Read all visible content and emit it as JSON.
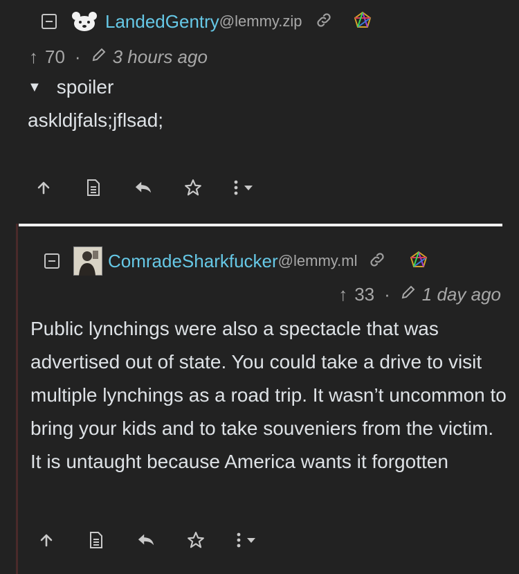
{
  "comments": [
    {
      "username": "LandedGentry",
      "instance": "@lemmy.zip",
      "score": "70",
      "arrow": "↑",
      "separator": "·",
      "time_ago": "3 hours ago",
      "spoiler_label": "spoiler",
      "spoiler_marker": "▼",
      "body": "askldjfals;jflsad;"
    },
    {
      "username": "ComradeSharkfucker",
      "instance": "@lemmy.ml",
      "score": "33",
      "arrow": "↑",
      "separator": "·",
      "time_ago": "1 day ago",
      "body": "Public lynchings were also a spectacle that was advertised out of state. You could take a drive to visit multiple lynchings as a road trip. It wasn’t uncommon to bring your kids and to take souveniers from the victim. It is untaught because America wants it forgotten"
    }
  ],
  "icons": {
    "collapse": "collapse-icon",
    "link": "link-icon",
    "fediverse": "fediverse-icon",
    "upvote": "upvote-icon",
    "source": "view-source-icon",
    "reply": "reply-icon",
    "save": "save-star-icon",
    "more": "more-options-icon",
    "edit": "edit-pencil-icon"
  },
  "colors": {
    "background": "#222222",
    "username": "#66c8e6",
    "text": "#dee2e6",
    "muted": "#a8a8a8"
  }
}
